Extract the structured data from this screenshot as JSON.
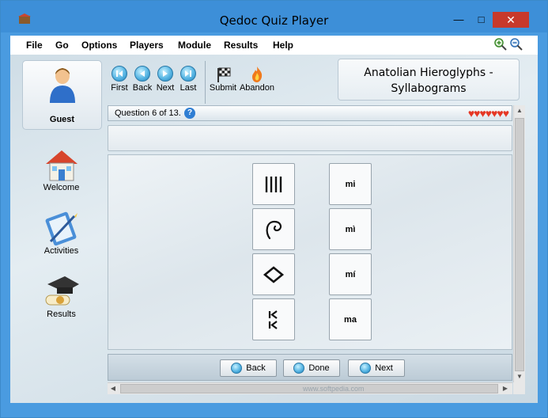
{
  "window": {
    "title": "Qedoc Quiz Player"
  },
  "menu": [
    "File",
    "Go",
    "Options",
    "Players",
    "Module",
    "Results",
    "Help"
  ],
  "user": {
    "name": "Guest"
  },
  "nav": [
    {
      "label": "Welcome"
    },
    {
      "label": "Activities"
    },
    {
      "label": "Results"
    }
  ],
  "toolbar": {
    "first": "First",
    "back": "Back",
    "next": "Next",
    "last": "Last",
    "submit": "Submit",
    "abandon": "Abandon"
  },
  "topic": {
    "line1": "Anatolian Hieroglyphs -",
    "line2": "Syllabograms"
  },
  "question": {
    "label": "Question 6 of 13.",
    "help": "?",
    "hearts": "♥♥♥♥♥♥♥"
  },
  "answers": [
    "mi",
    "mì",
    "mí",
    "ma"
  ],
  "buttons": {
    "back": "Back",
    "done": "Done",
    "next": "Next"
  },
  "watermark": "www.softpedia.com",
  "colors": {
    "titlebar": "#3d8fd8",
    "close": "#c7392b",
    "hearts": "#e53724"
  }
}
